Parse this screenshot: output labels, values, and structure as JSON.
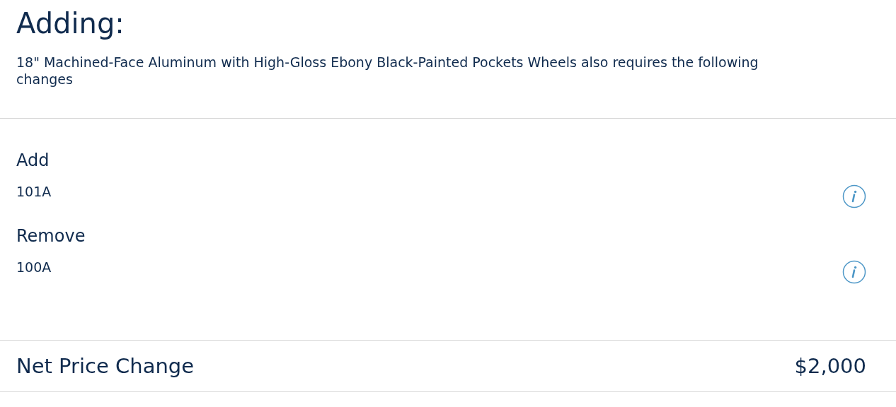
{
  "title": "Adding:",
  "message": "18\" Machined-Face Aluminum with High-Gloss Ebony Black-Painted Pockets Wheels also requires the following changes",
  "changes": [
    {
      "heading": "Add",
      "items": [
        {
          "code": "101A"
        }
      ]
    },
    {
      "heading": "Remove",
      "items": [
        {
          "code": "100A"
        }
      ]
    }
  ],
  "net": {
    "label": "Net Price Change",
    "value": "$2,000"
  }
}
